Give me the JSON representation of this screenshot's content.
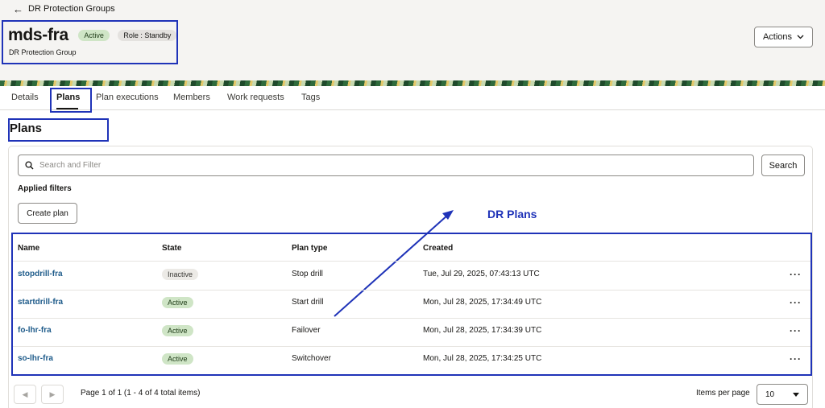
{
  "breadcrumb": {
    "back_label": "DR Protection Groups"
  },
  "header": {
    "title": "mds-fra",
    "status_badge": "Active",
    "role_badge": "Role : Standby",
    "subtitle": "DR Protection Group",
    "actions_label": "Actions"
  },
  "tabs": [
    {
      "label": "Details"
    },
    {
      "label": "Plans",
      "active": true
    },
    {
      "label": "Plan executions"
    },
    {
      "label": "Members"
    },
    {
      "label": "Work requests"
    },
    {
      "label": "Tags"
    }
  ],
  "section": {
    "title": "Plans",
    "search_placeholder": "Search and Filter",
    "search_button": "Search",
    "applied_filters": "Applied filters",
    "create_button": "Create plan"
  },
  "annotation": {
    "label": "DR Plans",
    "color": "#1f33b8"
  },
  "table": {
    "columns": [
      "Name",
      "State",
      "Plan type",
      "Created"
    ],
    "rows": [
      {
        "name": "stopdrill-fra",
        "state": "Inactive",
        "plan_type": "Stop drill",
        "created": "Tue, Jul 29, 2025, 07:43:13 UTC"
      },
      {
        "name": "startdrill-fra",
        "state": "Active",
        "plan_type": "Start drill",
        "created": "Mon, Jul 28, 2025, 17:34:49 UTC"
      },
      {
        "name": "fo-lhr-fra",
        "state": "Active",
        "plan_type": "Failover",
        "created": "Mon, Jul 28, 2025, 17:34:39 UTC"
      },
      {
        "name": "so-lhr-fra",
        "state": "Active",
        "plan_type": "Switchover",
        "created": "Mon, Jul 28, 2025, 17:34:25 UTC"
      }
    ],
    "row_menu": "···"
  },
  "pagination": {
    "summary": "Page 1 of 1 (1 - 4 of 4 total items)",
    "items_per_page_label": "Items per page",
    "items_per_page_value": "10"
  }
}
